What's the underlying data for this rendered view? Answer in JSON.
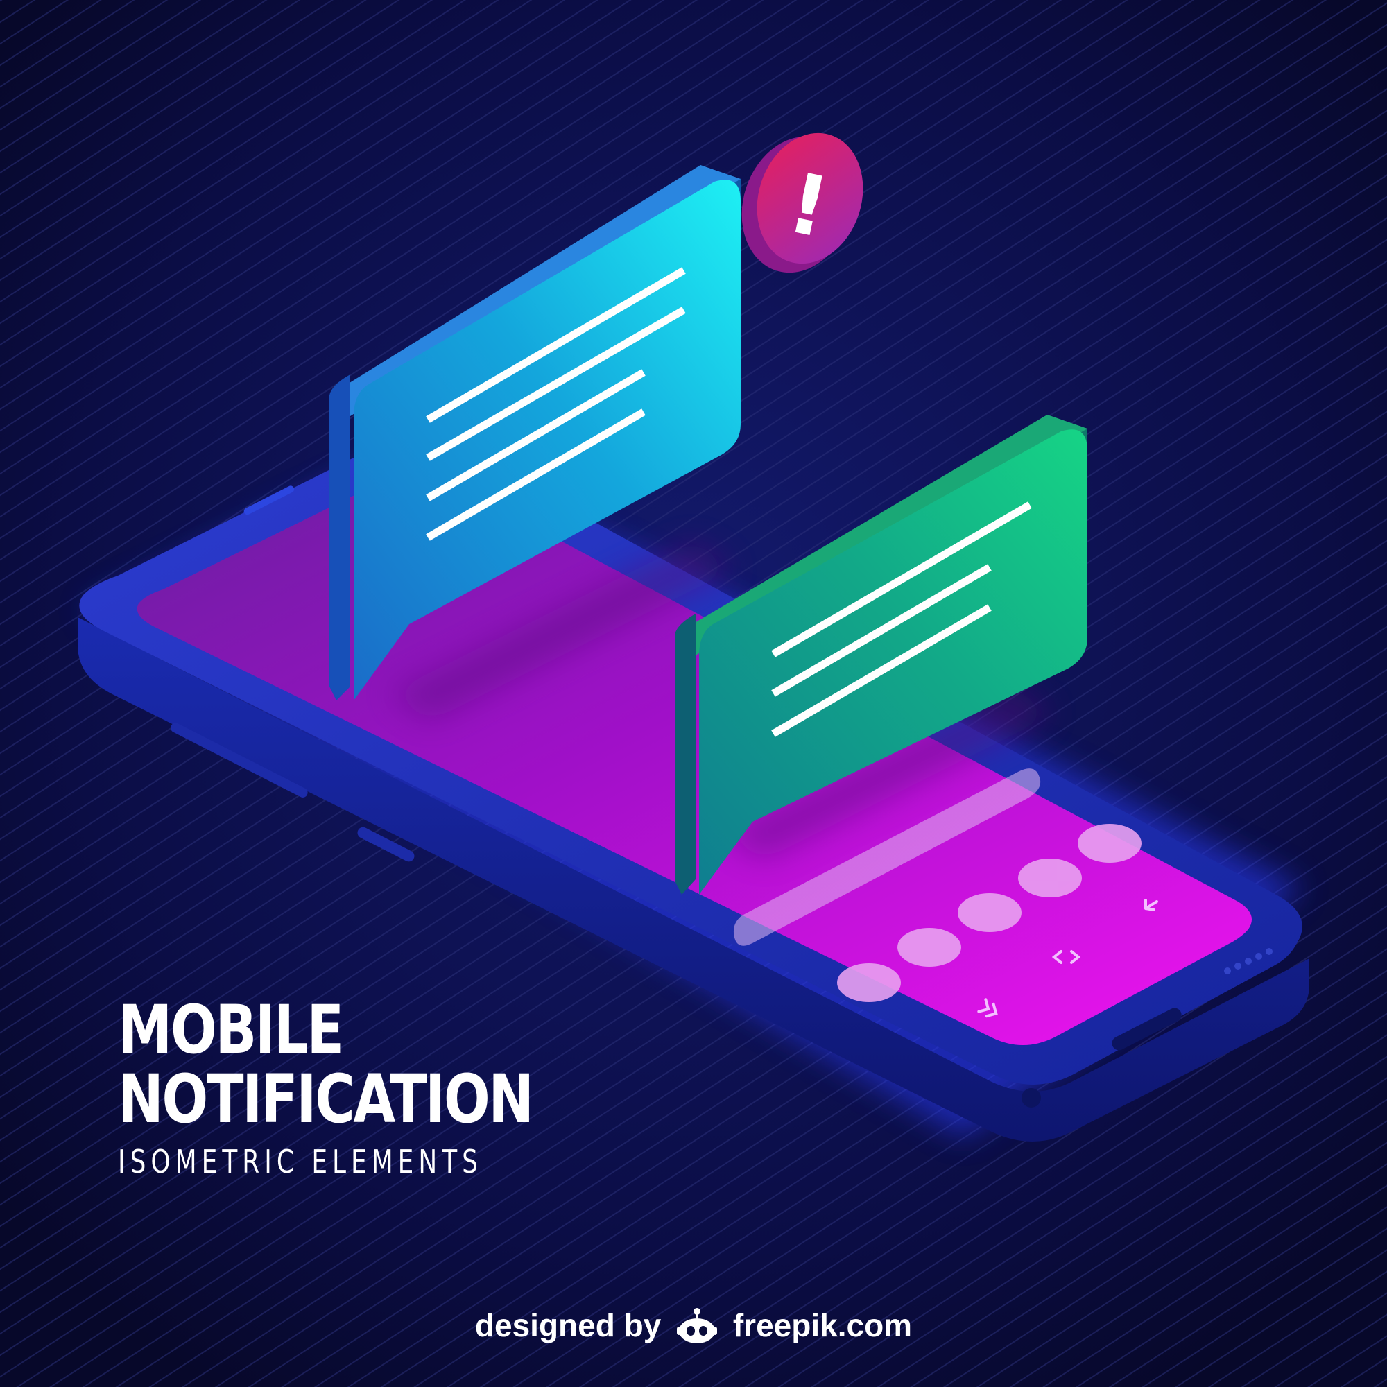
{
  "title": {
    "line1": "MOBILE",
    "line2": "NOTIFICATION",
    "subtitle": "ISOMETRIC ELEMENTS"
  },
  "alert_badge": {
    "symbol": "!",
    "color": "#d81b60"
  },
  "credit": {
    "prefix": "designed by",
    "brand": "freepik.com",
    "logo_icon": "freepik-logo-icon"
  },
  "colors": {
    "background": "#0a0c3a",
    "phone_body": "#1e2fc0",
    "screen": "#c014d0",
    "bubble_blue": "#13b6e0",
    "bubble_green": "#14c08a"
  }
}
